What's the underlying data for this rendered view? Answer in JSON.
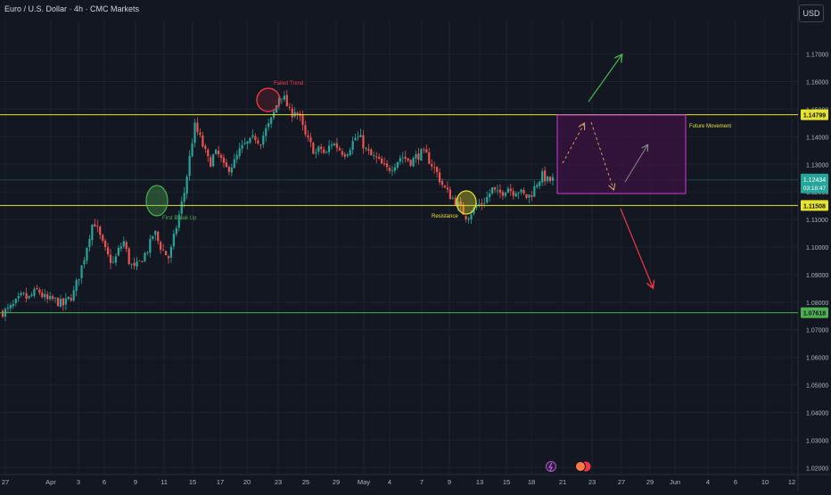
{
  "header": {
    "symbol_title": "Euro / U.S. Dollar · 4h · CMC Markets",
    "currency": "USD"
  },
  "colors": {
    "background": "#131722",
    "grid": "#1e222d",
    "up": "#26a69a",
    "down": "#ef5350",
    "yellow_line": "#e6e22e",
    "green_line": "#4caf50",
    "box_border": "#c93bd4",
    "box_fill": "#3a1340",
    "arrow_up": "#4caf50",
    "arrow_down": "#f23645",
    "dashed_arrow": "#c8a060",
    "solid_small_arrow": "#8a8a8a"
  },
  "chart_data": {
    "type": "candlestick",
    "title": "Euro / U.S. Dollar · 4h · CMC Markets",
    "ylim": [
      1.0175,
      1.1825
    ],
    "y_ticks": [
      "1.17000",
      "1.16000",
      "1.15000",
      "1.14000",
      "1.13000",
      "1.12000",
      "1.11000",
      "1.10000",
      "1.09000",
      "1.08000",
      "1.07000",
      "1.06000",
      "1.05000",
      "1.04000",
      "1.03000",
      "1.02000"
    ],
    "x_ticks": [
      "27",
      "Apr",
      "3",
      "6",
      "9",
      "11",
      "15",
      "17",
      "20",
      "23",
      "25",
      "29",
      "May",
      "4",
      "7",
      "9",
      "13",
      "15",
      "18",
      "21",
      "23",
      "27",
      "29",
      "Jun",
      "4",
      "6",
      "10",
      "12"
    ],
    "price_now": "1.12434",
    "countdown": "03:18:47",
    "levels": [
      {
        "label": "1.14799",
        "value": 1.14799,
        "color": "yellow"
      },
      {
        "label": "1.11508",
        "value": 1.11508,
        "color": "yellow"
      },
      {
        "label": "1.07618",
        "value": 1.07618,
        "color": "green"
      }
    ],
    "annotations": {
      "failed_trend": "Failed Trend",
      "first_break_up": "First Break Up",
      "resistance": "Resistance",
      "future_movement": "Future Movement"
    },
    "candles_anchor_close": [
      1.0765,
      1.077,
      1.0785,
      1.0805,
      1.0825,
      1.081,
      1.083,
      1.0845,
      1.082,
      1.0805,
      1.081,
      1.08,
      1.079,
      1.081,
      1.083,
      1.089,
      1.095,
      1.103,
      1.11,
      1.105,
      1.1,
      1.096,
      1.094,
      1.099,
      1.102,
      1.095,
      1.092,
      1.094,
      1.097,
      1.1,
      1.106,
      1.101,
      1.098,
      1.096,
      1.104,
      1.112,
      1.12,
      1.132,
      1.144,
      1.14,
      1.135,
      1.13,
      1.134,
      1.133,
      1.128,
      1.129,
      1.131,
      1.135,
      1.137,
      1.138,
      1.14,
      1.138,
      1.142,
      1.145,
      1.15,
      1.156,
      1.153,
      1.148,
      1.15,
      1.146,
      1.14,
      1.137,
      1.134,
      1.136,
      1.133,
      1.138,
      1.137,
      1.135,
      1.134,
      1.137,
      1.14,
      1.139,
      1.135,
      1.133,
      1.132,
      1.13,
      1.128,
      1.129,
      1.131,
      1.133,
      1.132,
      1.131,
      1.133,
      1.134,
      1.133,
      1.13,
      1.127,
      1.123,
      1.12,
      1.118,
      1.116,
      1.113,
      1.111,
      1.113,
      1.115,
      1.116,
      1.118,
      1.121,
      1.119,
      1.12,
      1.122,
      1.12,
      1.121,
      1.119,
      1.118,
      1.12,
      1.124,
      1.126,
      1.124,
      1.1243
    ]
  },
  "bottom_icons": [
    "lightning-icon",
    "flag-icon"
  ]
}
